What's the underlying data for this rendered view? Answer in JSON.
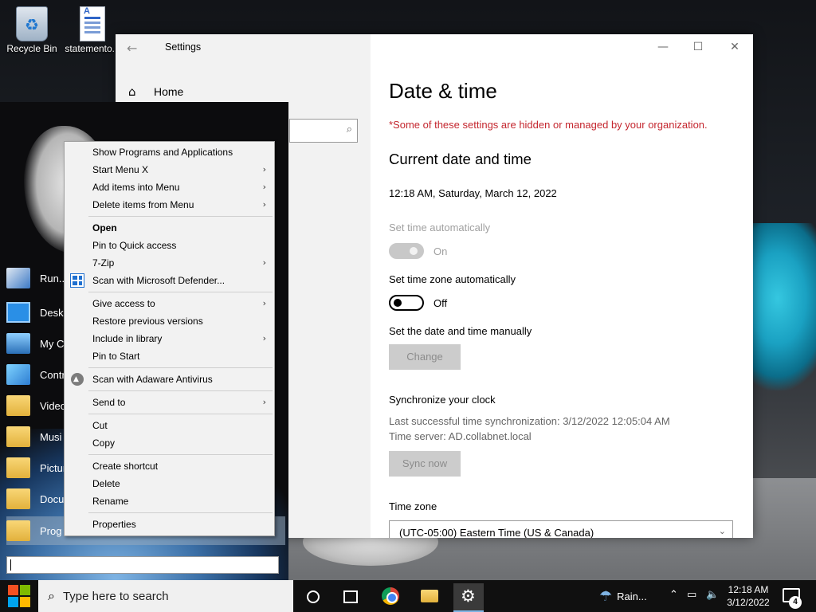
{
  "desktop": {
    "icons": [
      {
        "label": "Recycle Bin",
        "icon": "recycle-bin-icon"
      },
      {
        "label": "statemento...",
        "icon": "document-icon"
      }
    ]
  },
  "settings_window": {
    "title": "Settings",
    "nav_home": "Home",
    "page_title": "Date & time",
    "policy_note": "*Some of these settings are hidden or managed by your organization.",
    "section_current": "Current date and time",
    "current_datetime": "12:18 AM, Saturday, March 12, 2022",
    "set_time_auto": {
      "label": "Set time automatically",
      "state": "On"
    },
    "set_timezone_auto": {
      "label": "Set time zone automatically",
      "state": "Off"
    },
    "manual": {
      "label": "Set the date and time manually",
      "button": "Change"
    },
    "sync": {
      "title": "Synchronize your clock",
      "last_sync": "Last successful time synchronization: 3/12/2022 12:05:04 AM",
      "server": "Time server: AD.collabnet.local",
      "button": "Sync now"
    },
    "time_zone": {
      "label": "Time zone",
      "value": "(UTC-05:00) Eastern Time (US & Canada)"
    }
  },
  "start_menu": {
    "items": [
      "Run...",
      "Desk",
      "My C",
      "Contr",
      "Video",
      "Musi",
      "Pictur",
      "Docu",
      "Prog"
    ]
  },
  "context_menu": {
    "items": [
      "Show Programs and Applications",
      "Start Menu X",
      "Add items into Menu",
      "Delete items from Menu",
      "Open",
      "Pin to Quick access",
      "7-Zip",
      "Scan with Microsoft Defender...",
      "Give access to",
      "Restore previous versions",
      "Include in library",
      "Pin to Start",
      "Scan with Adaware Antivirus",
      "Send to",
      "Cut",
      "Copy",
      "Create shortcut",
      "Delete",
      "Rename",
      "Properties"
    ]
  },
  "taskbar": {
    "search_placeholder": "Type here to search",
    "weather": "Rain...",
    "time": "12:18 AM",
    "date": "3/12/2022",
    "notification_count": "4"
  },
  "colors": {
    "policy_red": "#c4262e",
    "windows_red": "#f25022",
    "windows_green": "#7fba00",
    "windows_blue": "#00a4ef",
    "windows_yellow": "#ffb900"
  }
}
